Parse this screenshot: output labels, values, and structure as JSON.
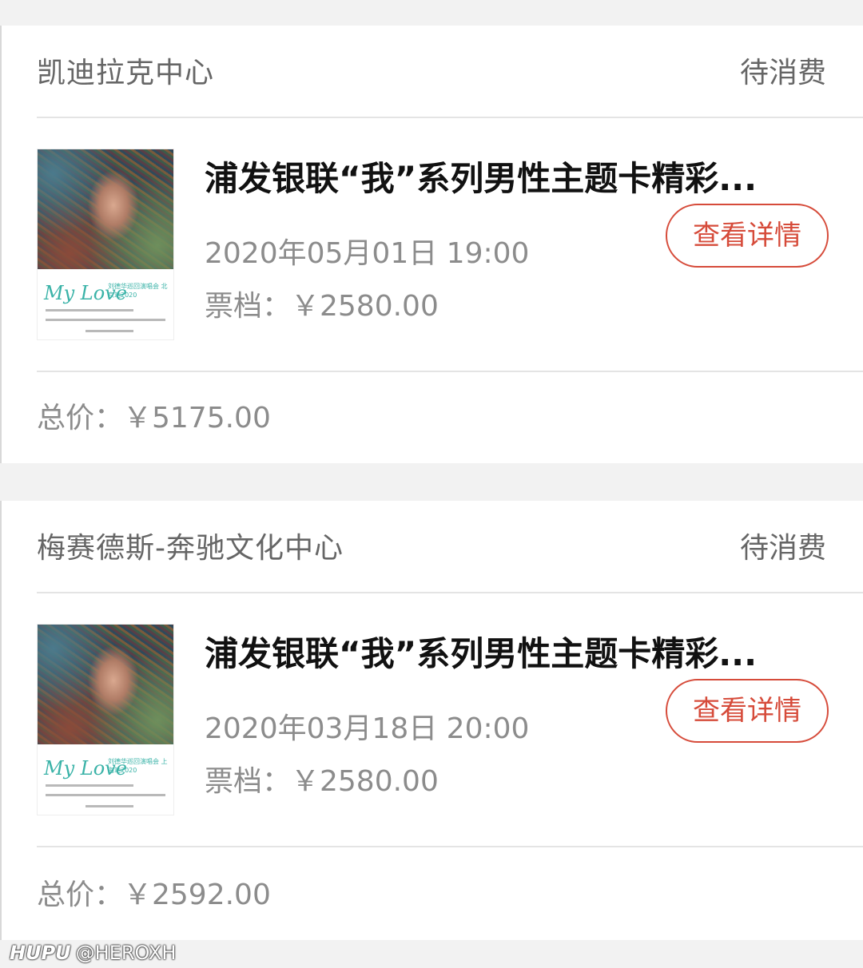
{
  "orders": [
    {
      "venue": "凯迪拉克中心",
      "status": "待消费",
      "title": "浦发银联“我”系列男性主题卡精彩...",
      "detail_button": "查看详情",
      "datetime": "2020年05月01日 19:00",
      "ticket_tier": "票档：￥2580.00",
      "total": "总价：￥5175.00",
      "poster": {
        "logo": "My Love",
        "subtitle": "刘德华巡回演唱会 北京站2020",
        "date_line": "2020-5-1/2/3"
      }
    },
    {
      "venue": "梅赛德斯-奔驰文化中心",
      "status": "待消费",
      "title": "浦发银联“我”系列男性主题卡精彩...",
      "detail_button": "查看详情",
      "datetime": "2020年03月18日 20:00",
      "ticket_tier": "票档：￥2580.00",
      "total": "总价：￥2592.00",
      "poster": {
        "logo": "My Love",
        "subtitle": "刘德华巡回演唱会 上海站2020",
        "date_line": "2020-3-18/19/20"
      }
    }
  ],
  "watermark": {
    "brand": "HUPU",
    "handle": "@HEROXH"
  },
  "colors": {
    "accent": "#d64b3a",
    "background": "#f2f2f2",
    "muted_text": "#8c8c8c",
    "title_text": "#111111"
  }
}
